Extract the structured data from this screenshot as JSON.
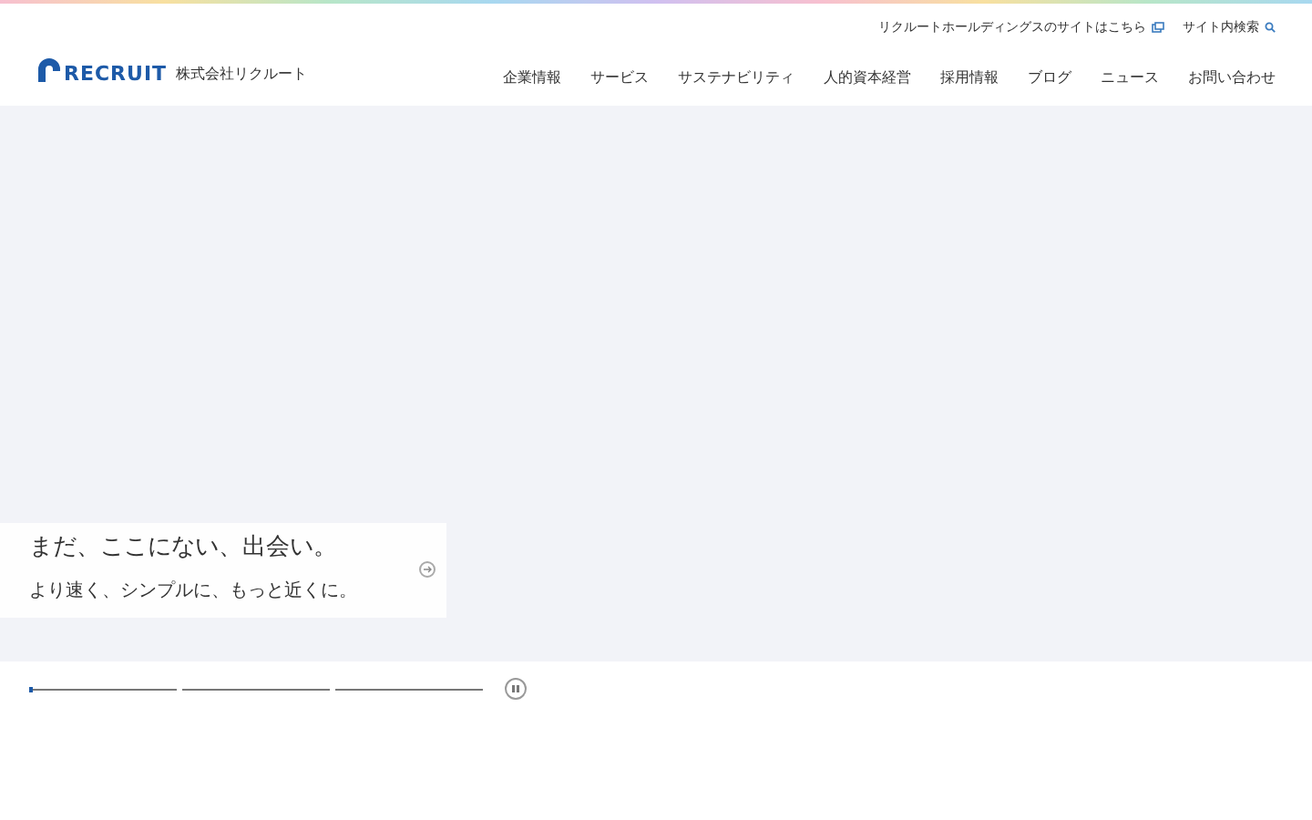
{
  "utility_links": [
    {
      "label": "リクルートホールディングスのサイトはこちら",
      "kind": "external"
    },
    {
      "label": "サイト内検索",
      "kind": "search"
    }
  ],
  "logo": {
    "wordmark": "RECRUIT",
    "company": "株式会社リクルート"
  },
  "nav": [
    "企業情報",
    "サービス",
    "サステナビリティ",
    "人的資本経営",
    "採用情報",
    "ブログ",
    "ニュース",
    "お問い合わせ"
  ],
  "hero": {
    "title": "まだ、ここにない、出会い。",
    "subtitle": "より速く、シンプルに、もっと近くに。"
  },
  "slides": [
    {
      "level": 0.02
    },
    {
      "level": 0
    },
    {
      "level": 0
    }
  ]
}
